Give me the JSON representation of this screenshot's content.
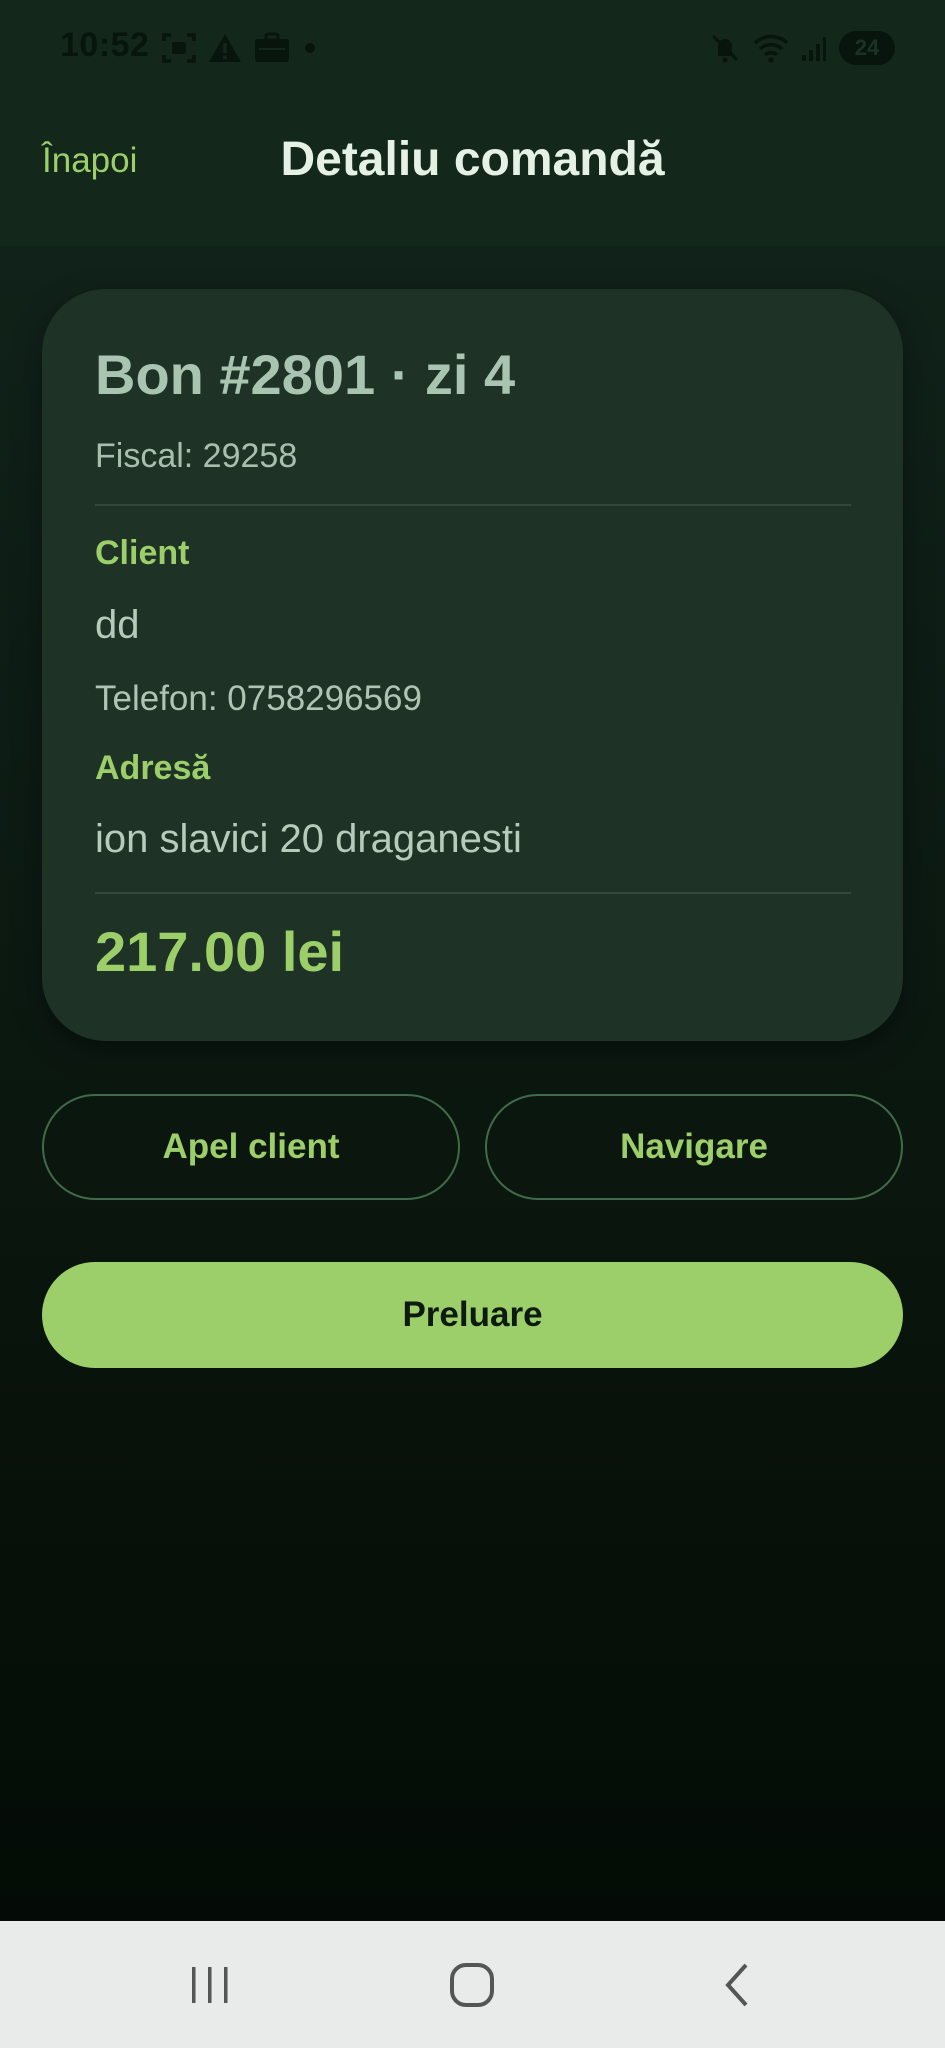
{
  "status_bar": {
    "time": "10:52",
    "battery": "24",
    "left_icons": [
      "screenshot-icon",
      "warning-icon",
      "briefcase-icon",
      "dot-icon"
    ],
    "right_icons": [
      "mute-icon",
      "wifi-icon",
      "signal-icon",
      "battery-icon"
    ]
  },
  "header": {
    "back_label": "Înapoi",
    "title": "Detaliu comandă"
  },
  "order": {
    "title": "Bon #2801 · zi 4",
    "fiscal": "Fiscal: 29258",
    "client_label": "Client",
    "client_name": "dd",
    "phone": "Telefon: 0758296569",
    "address_label": "Adresă",
    "address": "ion slavici 20 draganesti",
    "total": "217.00 lei"
  },
  "actions": {
    "call_label": "Apel client",
    "navigate_label": "Navigare",
    "pickup_label": "Preluare"
  },
  "nav_bar": {
    "items": [
      "recents-icon",
      "home-icon",
      "back-icon"
    ]
  },
  "colors": {
    "accent": "#9ccf6a",
    "background": "#0c1a12",
    "card": "#1e3326",
    "navbar": "#e9eaea"
  }
}
